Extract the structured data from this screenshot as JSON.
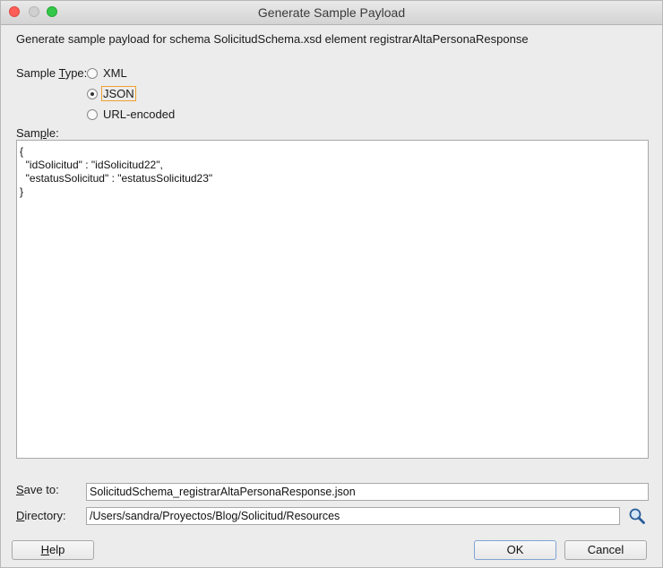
{
  "window": {
    "title": "Generate Sample Payload"
  },
  "description": "Generate sample payload for schema SolicitudSchema.xsd element registrarAltaPersonaResponse",
  "sample_type": {
    "label_pre": "Sample ",
    "label_accel": "T",
    "label_post": "ype:",
    "options": [
      {
        "label": "XML",
        "selected": false
      },
      {
        "label": "JSON",
        "selected": true
      },
      {
        "label": "URL-encoded",
        "selected": false
      }
    ]
  },
  "sample": {
    "label_pre": "Sam",
    "label_accel": "p",
    "label_post": "le:",
    "content": "{\n  \"idSolicitud\" : \"idSolicitud22\",\n  \"estatusSolicitud\" : \"estatusSolicitud23\"\n}"
  },
  "save_to": {
    "label_accel": "S",
    "label_post": "ave to:",
    "value": "SolicitudSchema_registrarAltaPersonaResponse.json"
  },
  "directory": {
    "label_accel": "D",
    "label_post": "irectory:",
    "value": "/Users/sandra/Proyectos/Blog/Solicitud/Resources",
    "browse_icon": "search-icon"
  },
  "buttons": {
    "help_accel": "H",
    "help_post": "elp",
    "ok": "OK",
    "cancel": "Cancel"
  },
  "colors": {
    "close": "#fc5f57",
    "maximize": "#34c84a",
    "focus_ring": "#f0a030"
  }
}
